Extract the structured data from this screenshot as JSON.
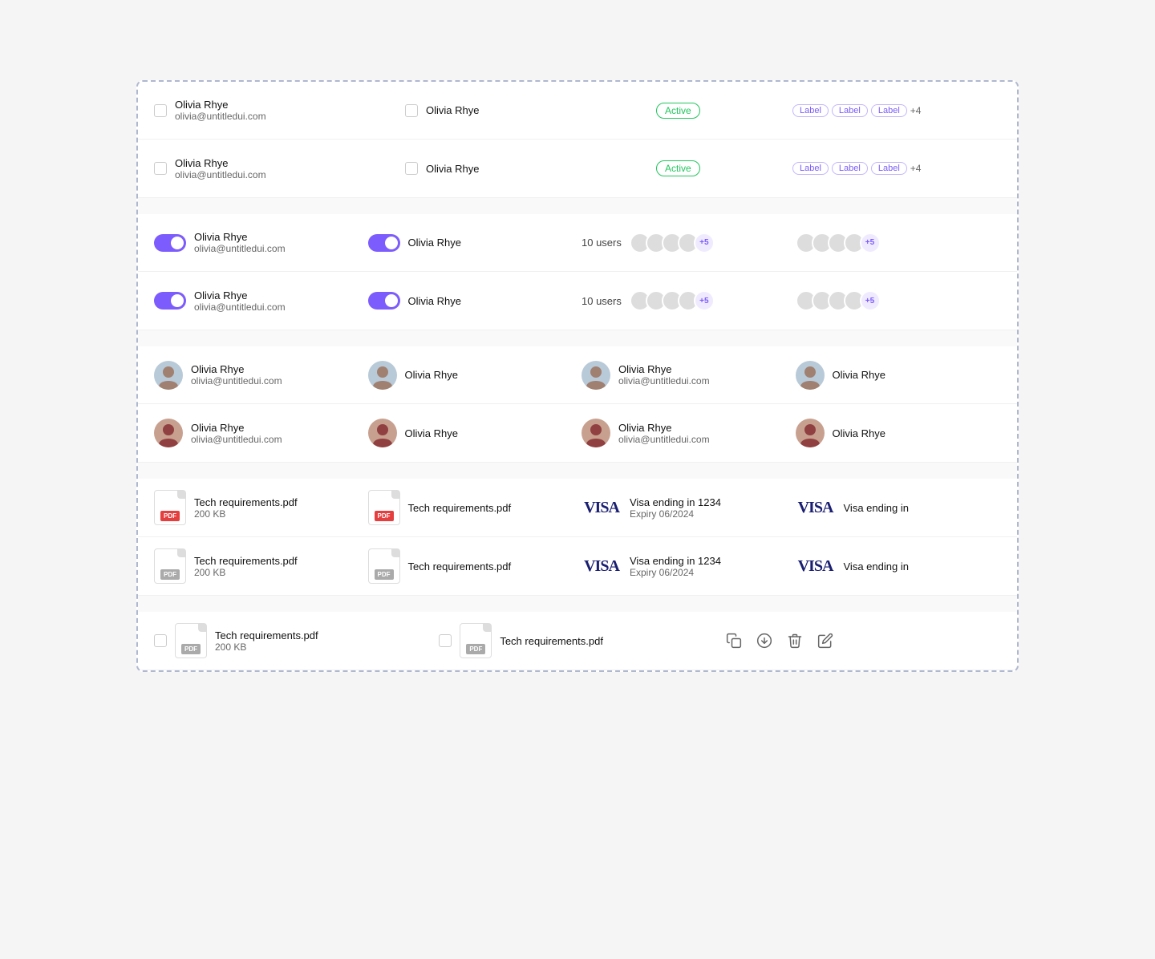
{
  "rows": {
    "checkbox_rows": [
      {
        "col1": {
          "name": "Olivia Rhye",
          "email": "olivia@untitledui.com"
        },
        "col2": {
          "name": "Olivia Rhye"
        },
        "status": "Active",
        "labels": [
          "Label",
          "Label",
          "Label"
        ],
        "more": "+4"
      },
      {
        "col1": {
          "name": "Olivia Rhye",
          "email": "olivia@untitledui.com"
        },
        "col2": {
          "name": "Olivia Rhye"
        },
        "status": "Active",
        "labels": [
          "Label",
          "Label",
          "Label"
        ],
        "more": "+4"
      }
    ],
    "toggle_rows": [
      {
        "col1": {
          "name": "Olivia Rhye",
          "email": "olivia@untitledui.com"
        },
        "col2": {
          "name": "Olivia Rhye"
        },
        "users_count": "10 users",
        "avatar_count": "+5",
        "avatar_count2": "+5"
      },
      {
        "col1": {
          "name": "Olivia Rhye",
          "email": "olivia@untitledui.com"
        },
        "col2": {
          "name": "Olivia Rhye"
        },
        "users_count": "10 users",
        "avatar_count": "+5",
        "avatar_count2": "+5"
      }
    ],
    "avatar_rows": [
      {
        "col1": {
          "name": "Olivia Rhye",
          "email": "olivia@untitledui.com"
        },
        "col2": {
          "name": "Olivia Rhye"
        },
        "col3": {
          "name": "Olivia Rhye",
          "email": "olivia@untitledui.com"
        },
        "col4": {
          "name": "Olivia Rhye"
        }
      },
      {
        "col1": {
          "name": "Olivia Rhye",
          "email": "olivia@untitledui.com"
        },
        "col2": {
          "name": "Olivia Rhye"
        },
        "col3": {
          "name": "Olivia Rhye",
          "email": "olivia@untitledui.com"
        },
        "col4": {
          "name": "Olivia Rhye"
        }
      }
    ],
    "file_rows": [
      {
        "col1": {
          "name": "Tech requirements.pdf",
          "size": "200 KB"
        },
        "col2": {
          "name": "Tech requirements.pdf"
        },
        "col3": {
          "visa_text": "Visa ending in 1234",
          "expiry": "Expiry 06/2024"
        },
        "col4": {
          "visa_partial": "Visa ending in"
        }
      },
      {
        "col1": {
          "name": "Tech requirements.pdf",
          "size": "200 KB"
        },
        "col2": {
          "name": "Tech requirements.pdf"
        },
        "col3": {
          "visa_text": "Visa ending in 1234",
          "expiry": "Expiry 06/2024"
        },
        "col4": {
          "visa_partial": "Visa ending in"
        }
      }
    ],
    "action_row": {
      "col1": {
        "name": "Tech requirements.pdf",
        "size": "200 KB"
      },
      "col2": {
        "name": "Tech requirements.pdf"
      },
      "actions": [
        "copy",
        "download",
        "delete",
        "edit"
      ]
    }
  },
  "labels": {
    "active": "Active",
    "label": "Label",
    "more4": "+4",
    "more5": "+5"
  }
}
